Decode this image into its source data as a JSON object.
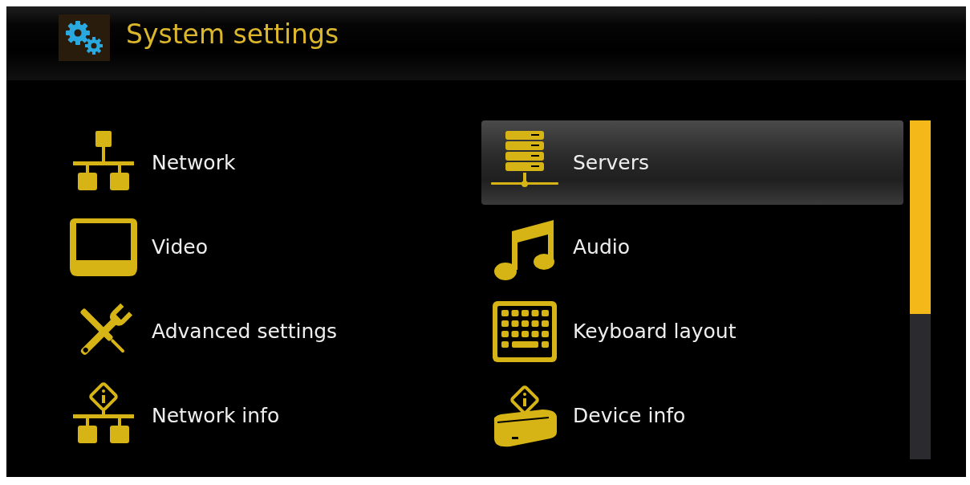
{
  "header": {
    "title": "System settings"
  },
  "items": [
    {
      "kind": "network",
      "label": "Network",
      "selected": false
    },
    {
      "kind": "servers",
      "label": "Servers",
      "selected": true
    },
    {
      "kind": "video",
      "label": "Video",
      "selected": false
    },
    {
      "kind": "audio",
      "label": "Audio",
      "selected": false
    },
    {
      "kind": "tools",
      "label": "Advanced settings",
      "selected": false
    },
    {
      "kind": "keyboard",
      "label": "Keyboard layout",
      "selected": false
    },
    {
      "kind": "network-info",
      "label": "Network info",
      "selected": false
    },
    {
      "kind": "device-info",
      "label": "Device info",
      "selected": false
    }
  ]
}
